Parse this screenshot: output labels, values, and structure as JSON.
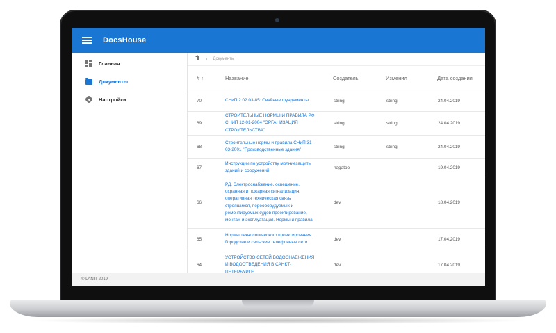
{
  "app": {
    "title": "DocsHouse"
  },
  "sidebar": {
    "items": [
      {
        "label": "Главная"
      },
      {
        "label": "Документы"
      },
      {
        "label": "Настройки"
      }
    ]
  },
  "breadcrumb": {
    "current": "Документы"
  },
  "table": {
    "columns": {
      "num": "#",
      "name": "Название",
      "creator": "Создатель",
      "modifier": "Изменил",
      "created": "Дата создания"
    },
    "rows": [
      {
        "num": "70",
        "name": "СНиП 2.02.03-85: Свайные фундаменты",
        "creator": "string",
        "modifier": "string",
        "created": "24.04.2019"
      },
      {
        "num": "69",
        "name": "СТРОИТЕЛЬНЫЕ НОРМЫ И ПРАВИЛА РФ СНИП 12-01-2004 \"ОРГАНИЗАЦИЯ СТРОИТЕЛЬСТВА\"",
        "creator": "string",
        "modifier": "string",
        "created": "24.04.2019"
      },
      {
        "num": "68",
        "name": "Строительные нормы и правила СНиП 31-03-2001 \"Производственные здания\"",
        "creator": "string",
        "modifier": "string",
        "created": "24.04.2019"
      },
      {
        "num": "67",
        "name": "Инструкции по устройству молниезащиты зданий и сооружений",
        "creator": "nagatoo",
        "modifier": "",
        "created": "19.04.2019"
      },
      {
        "num": "66",
        "name": "РД. Электроснабжение, освещение, охранная и пожарная сигнализация, оперативная техническая связь строящихся, переоборудуемых и ремонтируемых судов проектирование, монтаж и эксплуатация. Нормы и правила",
        "creator": "dev",
        "modifier": "",
        "created": "18.04.2019"
      },
      {
        "num": "65",
        "name": "Нормы технологического проектирования. Городские и сельские телефонные сети",
        "creator": "dev",
        "modifier": "",
        "created": "17.04.2019"
      },
      {
        "num": "64",
        "name": "УСТРОЙСТВО СЕТЕЙ ВОДОСНАБЖЕНИЯ И ВОДООТВЕДЕНИЯ В САНКТ-ПЕТЕРБУРГЕ",
        "creator": "dev",
        "modifier": "",
        "created": "17.04.2019"
      }
    ]
  },
  "footer": {
    "text": "© LANIT 2019"
  }
}
